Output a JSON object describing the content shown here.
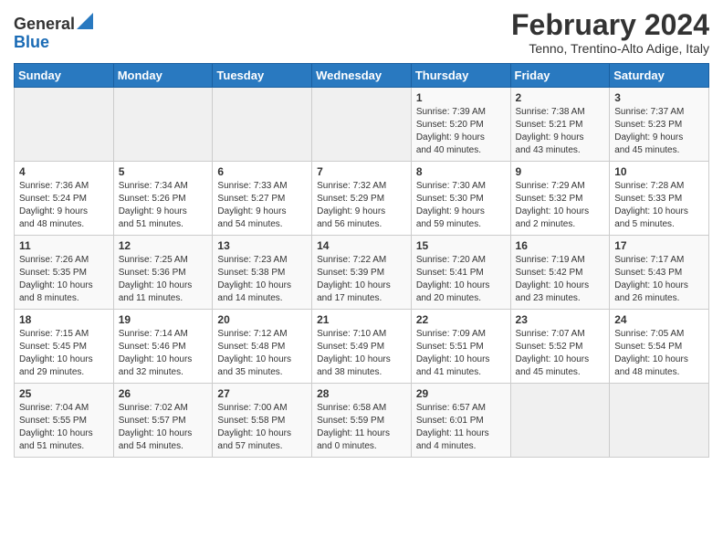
{
  "header": {
    "logo_general": "General",
    "logo_blue": "Blue",
    "month_title": "February 2024",
    "location": "Tenno, Trentino-Alto Adige, Italy"
  },
  "weekdays": [
    "Sunday",
    "Monday",
    "Tuesday",
    "Wednesday",
    "Thursday",
    "Friday",
    "Saturday"
  ],
  "weeks": [
    [
      {
        "day": "",
        "info": ""
      },
      {
        "day": "",
        "info": ""
      },
      {
        "day": "",
        "info": ""
      },
      {
        "day": "",
        "info": ""
      },
      {
        "day": "1",
        "info": "Sunrise: 7:39 AM\nSunset: 5:20 PM\nDaylight: 9 hours\nand 40 minutes."
      },
      {
        "day": "2",
        "info": "Sunrise: 7:38 AM\nSunset: 5:21 PM\nDaylight: 9 hours\nand 43 minutes."
      },
      {
        "day": "3",
        "info": "Sunrise: 7:37 AM\nSunset: 5:23 PM\nDaylight: 9 hours\nand 45 minutes."
      }
    ],
    [
      {
        "day": "4",
        "info": "Sunrise: 7:36 AM\nSunset: 5:24 PM\nDaylight: 9 hours\nand 48 minutes."
      },
      {
        "day": "5",
        "info": "Sunrise: 7:34 AM\nSunset: 5:26 PM\nDaylight: 9 hours\nand 51 minutes."
      },
      {
        "day": "6",
        "info": "Sunrise: 7:33 AM\nSunset: 5:27 PM\nDaylight: 9 hours\nand 54 minutes."
      },
      {
        "day": "7",
        "info": "Sunrise: 7:32 AM\nSunset: 5:29 PM\nDaylight: 9 hours\nand 56 minutes."
      },
      {
        "day": "8",
        "info": "Sunrise: 7:30 AM\nSunset: 5:30 PM\nDaylight: 9 hours\nand 59 minutes."
      },
      {
        "day": "9",
        "info": "Sunrise: 7:29 AM\nSunset: 5:32 PM\nDaylight: 10 hours\nand 2 minutes."
      },
      {
        "day": "10",
        "info": "Sunrise: 7:28 AM\nSunset: 5:33 PM\nDaylight: 10 hours\nand 5 minutes."
      }
    ],
    [
      {
        "day": "11",
        "info": "Sunrise: 7:26 AM\nSunset: 5:35 PM\nDaylight: 10 hours\nand 8 minutes."
      },
      {
        "day": "12",
        "info": "Sunrise: 7:25 AM\nSunset: 5:36 PM\nDaylight: 10 hours\nand 11 minutes."
      },
      {
        "day": "13",
        "info": "Sunrise: 7:23 AM\nSunset: 5:38 PM\nDaylight: 10 hours\nand 14 minutes."
      },
      {
        "day": "14",
        "info": "Sunrise: 7:22 AM\nSunset: 5:39 PM\nDaylight: 10 hours\nand 17 minutes."
      },
      {
        "day": "15",
        "info": "Sunrise: 7:20 AM\nSunset: 5:41 PM\nDaylight: 10 hours\nand 20 minutes."
      },
      {
        "day": "16",
        "info": "Sunrise: 7:19 AM\nSunset: 5:42 PM\nDaylight: 10 hours\nand 23 minutes."
      },
      {
        "day": "17",
        "info": "Sunrise: 7:17 AM\nSunset: 5:43 PM\nDaylight: 10 hours\nand 26 minutes."
      }
    ],
    [
      {
        "day": "18",
        "info": "Sunrise: 7:15 AM\nSunset: 5:45 PM\nDaylight: 10 hours\nand 29 minutes."
      },
      {
        "day": "19",
        "info": "Sunrise: 7:14 AM\nSunset: 5:46 PM\nDaylight: 10 hours\nand 32 minutes."
      },
      {
        "day": "20",
        "info": "Sunrise: 7:12 AM\nSunset: 5:48 PM\nDaylight: 10 hours\nand 35 minutes."
      },
      {
        "day": "21",
        "info": "Sunrise: 7:10 AM\nSunset: 5:49 PM\nDaylight: 10 hours\nand 38 minutes."
      },
      {
        "day": "22",
        "info": "Sunrise: 7:09 AM\nSunset: 5:51 PM\nDaylight: 10 hours\nand 41 minutes."
      },
      {
        "day": "23",
        "info": "Sunrise: 7:07 AM\nSunset: 5:52 PM\nDaylight: 10 hours\nand 45 minutes."
      },
      {
        "day": "24",
        "info": "Sunrise: 7:05 AM\nSunset: 5:54 PM\nDaylight: 10 hours\nand 48 minutes."
      }
    ],
    [
      {
        "day": "25",
        "info": "Sunrise: 7:04 AM\nSunset: 5:55 PM\nDaylight: 10 hours\nand 51 minutes."
      },
      {
        "day": "26",
        "info": "Sunrise: 7:02 AM\nSunset: 5:57 PM\nDaylight: 10 hours\nand 54 minutes."
      },
      {
        "day": "27",
        "info": "Sunrise: 7:00 AM\nSunset: 5:58 PM\nDaylight: 10 hours\nand 57 minutes."
      },
      {
        "day": "28",
        "info": "Sunrise: 6:58 AM\nSunset: 5:59 PM\nDaylight: 11 hours\nand 0 minutes."
      },
      {
        "day": "29",
        "info": "Sunrise: 6:57 AM\nSunset: 6:01 PM\nDaylight: 11 hours\nand 4 minutes."
      },
      {
        "day": "",
        "info": ""
      },
      {
        "day": "",
        "info": ""
      }
    ]
  ]
}
